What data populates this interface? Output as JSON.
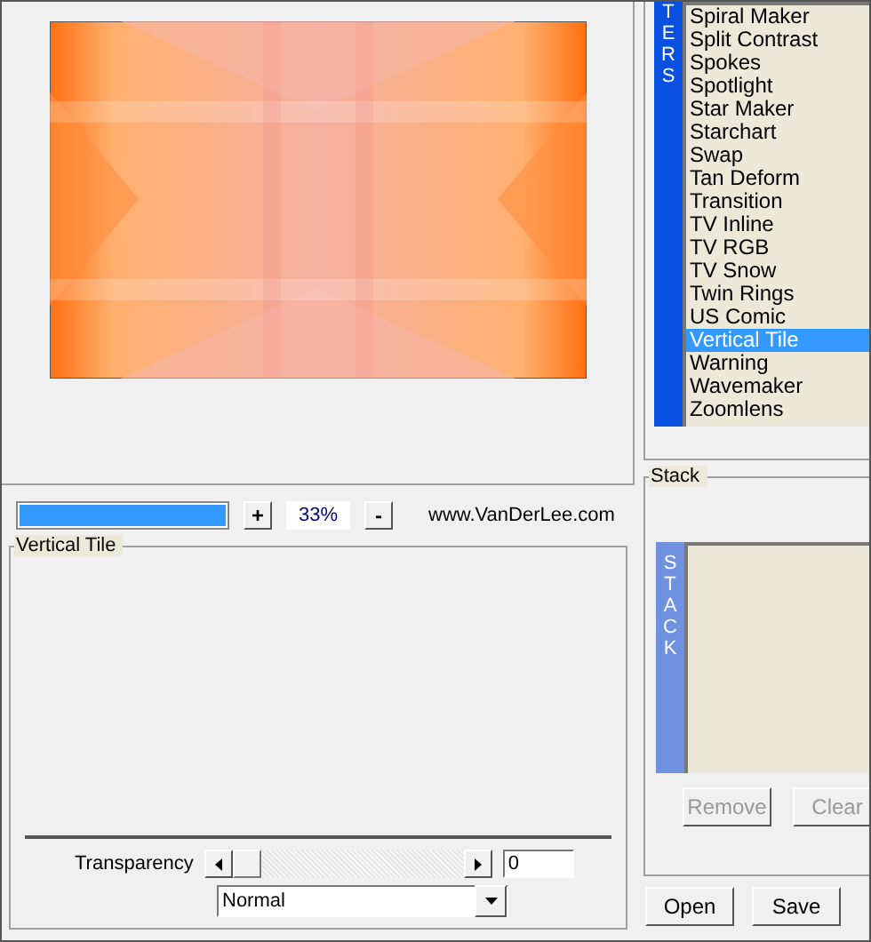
{
  "preview": {
    "progress": {
      "level": 1
    },
    "zoom_in": "+",
    "zoom": "33%",
    "zoom_out": "-",
    "website": "www.VanDerLee.com"
  },
  "filters": {
    "strip": "TERS",
    "items": [
      {
        "label": "Spiral Maker",
        "selected": false
      },
      {
        "label": "Split Contrast",
        "selected": false
      },
      {
        "label": "Spokes",
        "selected": false
      },
      {
        "label": "Spotlight",
        "selected": false
      },
      {
        "label": "Star Maker",
        "selected": false
      },
      {
        "label": "Starchart",
        "selected": false
      },
      {
        "label": "Swap",
        "selected": false
      },
      {
        "label": "Tan Deform",
        "selected": false
      },
      {
        "label": "Transition",
        "selected": false
      },
      {
        "label": "TV Inline",
        "selected": false
      },
      {
        "label": "TV RGB",
        "selected": false
      },
      {
        "label": "TV Snow",
        "selected": false
      },
      {
        "label": "Twin Rings",
        "selected": false
      },
      {
        "label": "US Comic",
        "selected": false
      },
      {
        "label": "Vertical Tile",
        "selected": true
      },
      {
        "label": "Warning",
        "selected": false
      },
      {
        "label": "Wavemaker",
        "selected": false
      },
      {
        "label": "Zoomlens",
        "selected": false
      }
    ]
  },
  "settings": {
    "title": "Vertical Tile",
    "transparency": {
      "label": "Transparency",
      "level": 0,
      "value": "0"
    },
    "blend_mode": "Normal"
  },
  "stack": {
    "title": "Stack",
    "strip": "STACK",
    "buttons": [
      {
        "label": "Remove",
        "disabled": true
      },
      {
        "label": "Clear",
        "disabled": true
      }
    ]
  },
  "buttons": [
    "Open",
    "Save"
  ]
}
